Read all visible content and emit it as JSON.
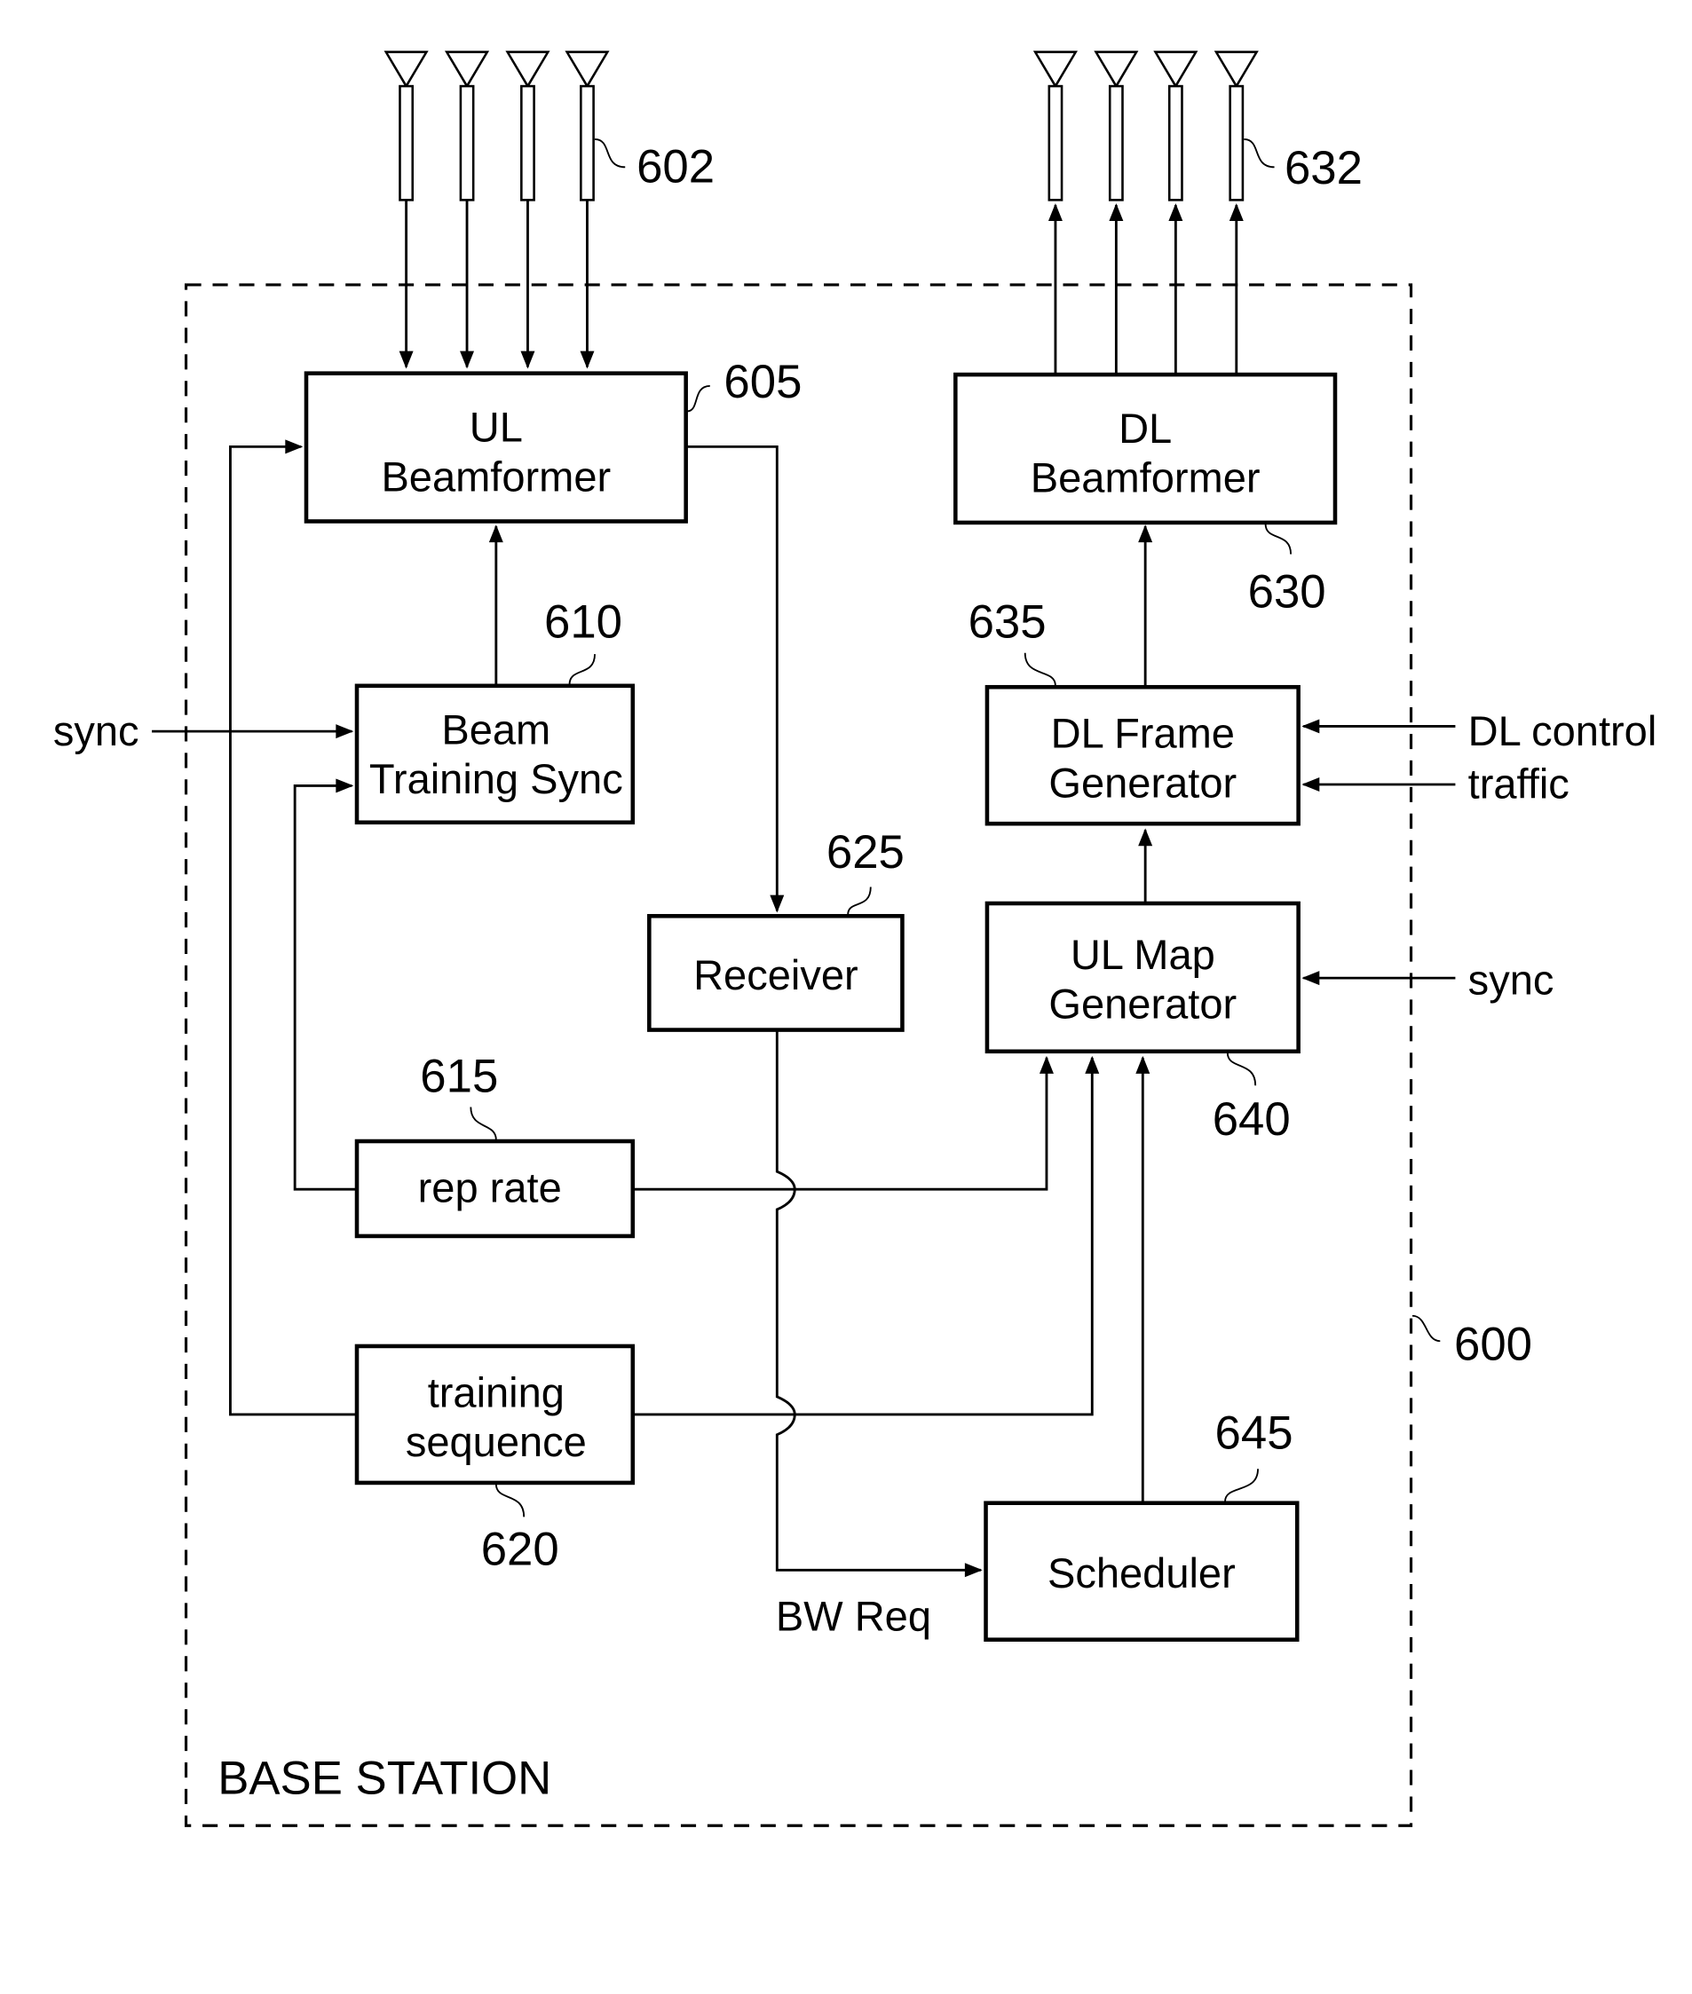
{
  "figure": {
    "container": {
      "label": "BASE STATION",
      "ref": "600"
    },
    "antennas": {
      "uplink": {
        "ref": "602",
        "count": 4
      },
      "downlink": {
        "ref": "632",
        "count": 4
      }
    },
    "blocks": {
      "ul_beamformer": {
        "ref": "605",
        "lines": [
          "UL",
          "Beamformer"
        ]
      },
      "beam_training_sync": {
        "ref": "610",
        "lines": [
          "Beam",
          "Training Sync"
        ]
      },
      "rep_rate": {
        "ref": "615",
        "lines": [
          "rep rate"
        ]
      },
      "training_sequence": {
        "ref": "620",
        "lines": [
          "training",
          "sequence"
        ]
      },
      "receiver": {
        "ref": "625",
        "lines": [
          "Receiver"
        ]
      },
      "dl_beamformer": {
        "ref": "630",
        "lines": [
          "DL",
          "Beamformer"
        ]
      },
      "dl_frame_generator": {
        "ref": "635",
        "lines": [
          "DL Frame",
          "Generator"
        ]
      },
      "ul_map_generator": {
        "ref": "640",
        "lines": [
          "UL Map",
          "Generator"
        ]
      },
      "scheduler": {
        "ref": "645",
        "lines": [
          "Scheduler"
        ]
      }
    },
    "signals": {
      "sync_left": "sync",
      "dl_control": "DL control",
      "traffic": "traffic",
      "sync_right": "sync",
      "bw_req": "BW Req"
    }
  }
}
